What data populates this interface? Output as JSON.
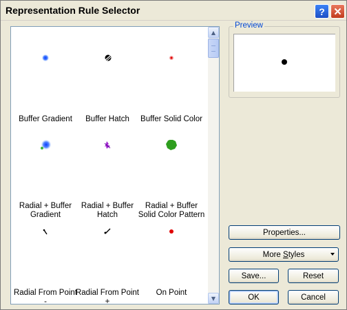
{
  "window": {
    "title": "Representation Rule Selector"
  },
  "titlebar": {
    "help_glyph": "?",
    "close_glyph": "✕"
  },
  "gallery": {
    "items": [
      {
        "label": "Buffer Gradient",
        "icon": "buffer-gradient-icon"
      },
      {
        "label": "Buffer Hatch",
        "icon": "buffer-hatch-icon"
      },
      {
        "label": "Buffer Solid Color",
        "icon": "buffer-solid-color-icon"
      },
      {
        "label": "Radial + Buffer\nGradient",
        "icon": "radial-buffer-gradient-icon"
      },
      {
        "label": "Radial + Buffer\nHatch",
        "icon": "radial-buffer-hatch-icon"
      },
      {
        "label": "Radial + Buffer\nSolid Color Pattern",
        "icon": "radial-buffer-solid-color-pattern-icon"
      },
      {
        "label": "Radial From Point\n-",
        "icon": "radial-from-point-minus-icon"
      },
      {
        "label": "Radial From Point\n+",
        "icon": "radial-from-point-plus-icon"
      },
      {
        "label": "On Point",
        "icon": "on-point-icon"
      }
    ],
    "scroll_up_glyph": "▲",
    "scroll_down_glyph": "▼"
  },
  "preview": {
    "label": "Preview"
  },
  "buttons": {
    "properties": "Properties...",
    "more_styles_pre": "More ",
    "more_styles_access": "S",
    "more_styles_post": "tyles",
    "save": "Save...",
    "reset": "Reset",
    "ok": "OK",
    "cancel": "Cancel"
  },
  "colors": {
    "accent_blue": "#0046d5",
    "dot_red": "#e00000",
    "dot_green": "#2e9e1e",
    "dot_purple": "#a020d0"
  }
}
